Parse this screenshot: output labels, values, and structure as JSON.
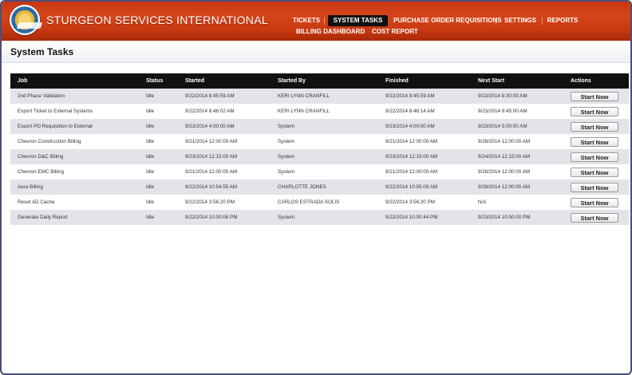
{
  "app": {
    "title": "STURGEON SERVICES INTERNATIONAL"
  },
  "nav": {
    "items": [
      {
        "label": "TICKETS",
        "active": false
      },
      {
        "label": "SYSTEM TASKS",
        "active": true
      },
      {
        "label": "PURCHASE ORDER REQUISITIONS",
        "active": false
      },
      {
        "label": "SETTINGS",
        "active": false
      },
      {
        "label": "REPORTS",
        "active": false
      }
    ],
    "sub_items": [
      {
        "label": "BILLING DASHBOARD"
      },
      {
        "label": "COST REPORT"
      }
    ]
  },
  "page": {
    "title": "System Tasks"
  },
  "table": {
    "headers": [
      "Job",
      "Status",
      "Started",
      "Started By",
      "Finished",
      "Next Start",
      "Actions"
    ],
    "action_label": "Start Now",
    "rows": [
      {
        "job": "2nd Phase Validation",
        "status": "Idle",
        "started": "9/22/2014 8:45:59 AM",
        "started_by": "KERI LYNN CRANFILL",
        "finished": "9/22/2014 8:45:59 AM",
        "next_start": "9/23/2014 8:30:00 AM"
      },
      {
        "job": "Export Ticket to External Systems",
        "status": "Idle",
        "started": "9/22/2014 8:46:02 AM",
        "started_by": "KERI LYNN CRANFILL",
        "finished": "9/22/2014 8:46:14 AM",
        "next_start": "9/23/2014 8:45:00 AM"
      },
      {
        "job": "Export PO Requisition to External",
        "status": "Idle",
        "started": "9/23/2014 4:00:00 AM",
        "started_by": "System",
        "finished": "9/23/2014 4:00:00 AM",
        "next_start": "9/23/2014 5:00:00 AM"
      },
      {
        "job": "Chevron Construction Billing",
        "status": "Idle",
        "started": "9/21/2014 12:00:00 AM",
        "started_by": "System",
        "finished": "9/21/2014 12:00:00 AM",
        "next_start": "9/28/2014 12:00:00 AM"
      },
      {
        "job": "Chevron D&C Billing",
        "status": "Idle",
        "started": "9/23/2014 12:15:00 AM",
        "started_by": "System",
        "finished": "9/23/2014 12:15:00 AM",
        "next_start": "9/24/2014 12:15:00 AM"
      },
      {
        "job": "Chevron EMC Billing",
        "status": "Idle",
        "started": "9/21/2014 12:00:00 AM",
        "started_by": "System",
        "finished": "9/21/2014 12:00:00 AM",
        "next_start": "9/28/2014 12:00:00 AM"
      },
      {
        "job": "Aera Billing",
        "status": "Idle",
        "started": "9/22/2014 10:54:55 AM",
        "started_by": "CHARLOTTE JONES",
        "finished": "9/22/2014 10:55:09 AM",
        "next_start": "9/28/2014 12:00:00 AM"
      },
      {
        "job": "Reset AD Cache",
        "status": "Idle",
        "started": "9/22/2014 3:56:20 PM",
        "started_by": "CARLOS ESTRADA SOLIS",
        "finished": "9/22/2014 3:56:20 PM",
        "next_start": "N/A"
      },
      {
        "job": "Generate Daily Report",
        "status": "Idle",
        "started": "9/22/2014 10:00:08 PM",
        "started_by": "System",
        "finished": "9/22/2014 10:00:44 PM",
        "next_start": "9/23/2014 10:00:00 PM"
      }
    ]
  },
  "colors": {
    "header": "#c93a12",
    "nav_active": "#111111",
    "table_header": "#111111",
    "row_alt": "#e3e4ea"
  },
  "icons": {
    "logo": "company-seal-logo"
  }
}
